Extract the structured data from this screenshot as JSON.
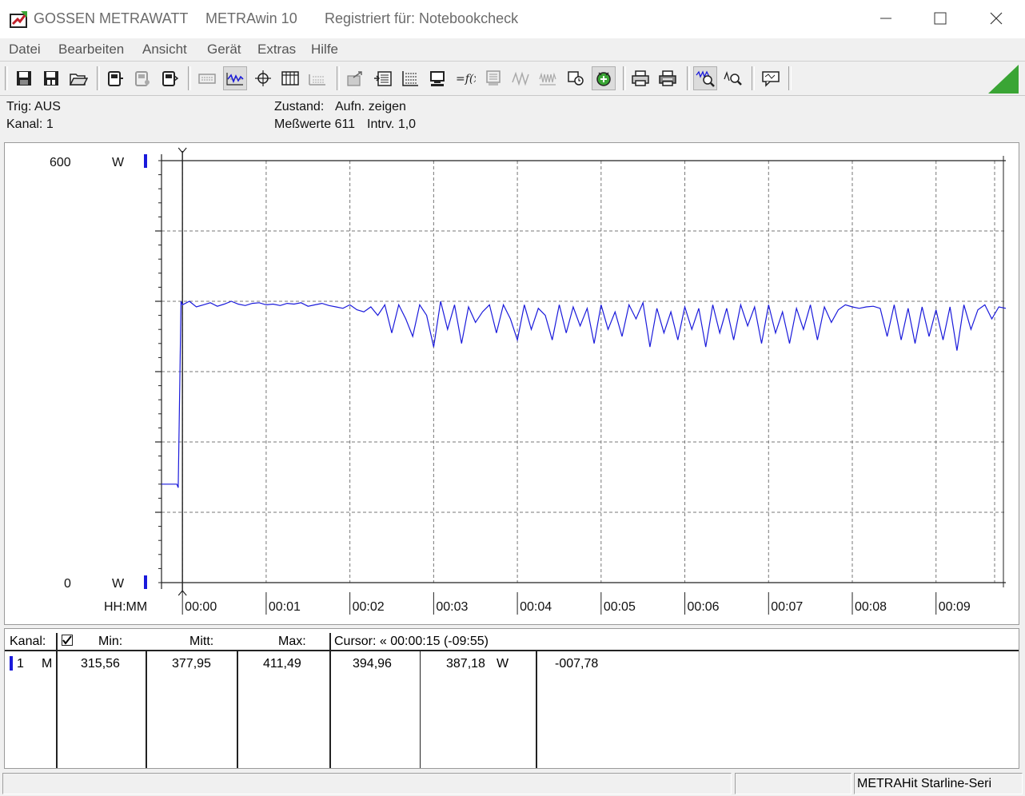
{
  "window": {
    "company": "GOSSEN METRAWATT",
    "app_name": "METRAwin 10",
    "registered": "Registriert für: Notebookcheck",
    "controls": {
      "minimize_icon": "minimize-icon",
      "maximize_icon": "maximize-icon",
      "close_icon": "close-icon"
    }
  },
  "menu": [
    "Datei",
    "Bearbeiten",
    "Ansicht",
    "Gerät",
    "Extras",
    "Hilfe"
  ],
  "toolbar": {
    "icons": [
      "save-icon",
      "save-as-icon",
      "open-folder-icon",
      "device-read-icon",
      "device-settings-icon",
      "device-send-icon",
      "keyboard-icon",
      "waveform-icon",
      "crosshair-icon",
      "table-icon",
      "grid-icon",
      "export-icon",
      "import-icon",
      "scope-icon",
      "computer-icon",
      "function-icon",
      "monitor-icon",
      "signal-icon",
      "signal-alt-icon",
      "record-icon",
      "trigger-icon",
      "print-icon",
      "print-preview-icon",
      "zoom-wave-icon",
      "zoom-icon",
      "message-icon"
    ],
    "pressed": [
      "waveform-icon",
      "trigger-icon",
      "zoom-wave-icon"
    ]
  },
  "info": {
    "trigger": "Trig: AUS",
    "channel": "Kanal: 1",
    "state_label": "Zustand:",
    "state_value": "Aufn. zeigen",
    "samples": "Meßwerte 611",
    "interval": "Intrv. 1,0"
  },
  "chart_data": {
    "type": "line",
    "title": "",
    "ylabel": "W",
    "xlabel": "HH:MM",
    "ylim": [
      0,
      600
    ],
    "y_tick_labels": [
      "600",
      "0"
    ],
    "y_unit": "W",
    "x_tick_labels": [
      "00:00",
      "00:01",
      "00:02",
      "00:03",
      "00:04",
      "00:05",
      "00:06",
      "00:07",
      "00:08",
      "00:09"
    ],
    "xlim_seconds": [
      -15,
      590
    ],
    "grid": true,
    "cursor_x_seconds": 0,
    "series": [
      {
        "color": "#1a1adb",
        "x_seconds": [
          -15,
          -4,
          -3,
          -2,
          -1,
          0,
          5,
          10,
          15,
          20,
          25,
          30,
          35,
          40,
          45,
          50,
          55,
          60,
          65,
          70,
          75,
          80,
          85,
          90,
          95,
          100,
          105,
          110,
          115,
          120,
          125,
          130,
          135,
          140,
          145,
          150,
          155,
          160,
          165,
          170,
          175,
          180,
          185,
          190,
          195,
          200,
          205,
          210,
          215,
          220,
          225,
          230,
          235,
          240,
          245,
          250,
          255,
          260,
          265,
          270,
          275,
          280,
          285,
          290,
          295,
          300,
          305,
          310,
          315,
          320,
          325,
          330,
          335,
          340,
          345,
          350,
          355,
          360,
          365,
          370,
          375,
          380,
          385,
          390,
          395,
          400,
          405,
          410,
          415,
          420,
          425,
          430,
          435,
          440,
          445,
          450,
          455,
          460,
          465,
          470,
          475,
          480,
          485,
          490,
          495,
          500,
          505,
          510,
          515,
          520,
          525,
          530,
          535,
          540,
          545,
          550,
          555,
          560,
          565,
          570,
          575,
          580,
          585,
          590
        ],
        "values": [
          140,
          140,
          135,
          270,
          400,
          395,
          400,
          392,
          395,
          398,
          393,
          396,
          400,
          396,
          394,
          397,
          398,
          395,
          396,
          394,
          397,
          396,
          398,
          393,
          395,
          397,
          394,
          392,
          390,
          395,
          388,
          385,
          392,
          380,
          395,
          355,
          395,
          375,
          350,
          395,
          380,
          335,
          400,
          360,
          395,
          340,
          392,
          370,
          385,
          395,
          355,
          395,
          375,
          345,
          395,
          360,
          390,
          380,
          345,
          395,
          355,
          392,
          365,
          390,
          340,
          395,
          360,
          385,
          350,
          395,
          375,
          398,
          335,
          390,
          355,
          385,
          345,
          392,
          360,
          390,
          335,
          395,
          355,
          390,
          345,
          395,
          365,
          392,
          340,
          395,
          355,
          385,
          340,
          390,
          360,
          395,
          345,
          392,
          370,
          388,
          395,
          392,
          390,
          392,
          393,
          390,
          350,
          395,
          345,
          390,
          340,
          392,
          350,
          388,
          345,
          392,
          330,
          395,
          360,
          388,
          395,
          375,
          392,
          390
        ]
      }
    ]
  },
  "table": {
    "headers": {
      "kanal": "Kanal:",
      "min": "Min:",
      "mitt": "Mitt:",
      "max": "Max:",
      "cursor": "Cursor: « 00:00:15 (-09:55)"
    },
    "checkbox_checked": true,
    "row": {
      "channel": "1",
      "mode": "M",
      "min": "315,56",
      "mitt": "377,95",
      "max": "411,49",
      "cursor_value": "394,96",
      "cursor_value2": "387,18",
      "unit": "W",
      "diff": "-007,78"
    }
  },
  "status": {
    "device": "METRAHit Starline-Seri"
  },
  "colors": {
    "trace": "#1a1adb",
    "marker": "#1a1adb",
    "corner_green": "#3aa535"
  }
}
